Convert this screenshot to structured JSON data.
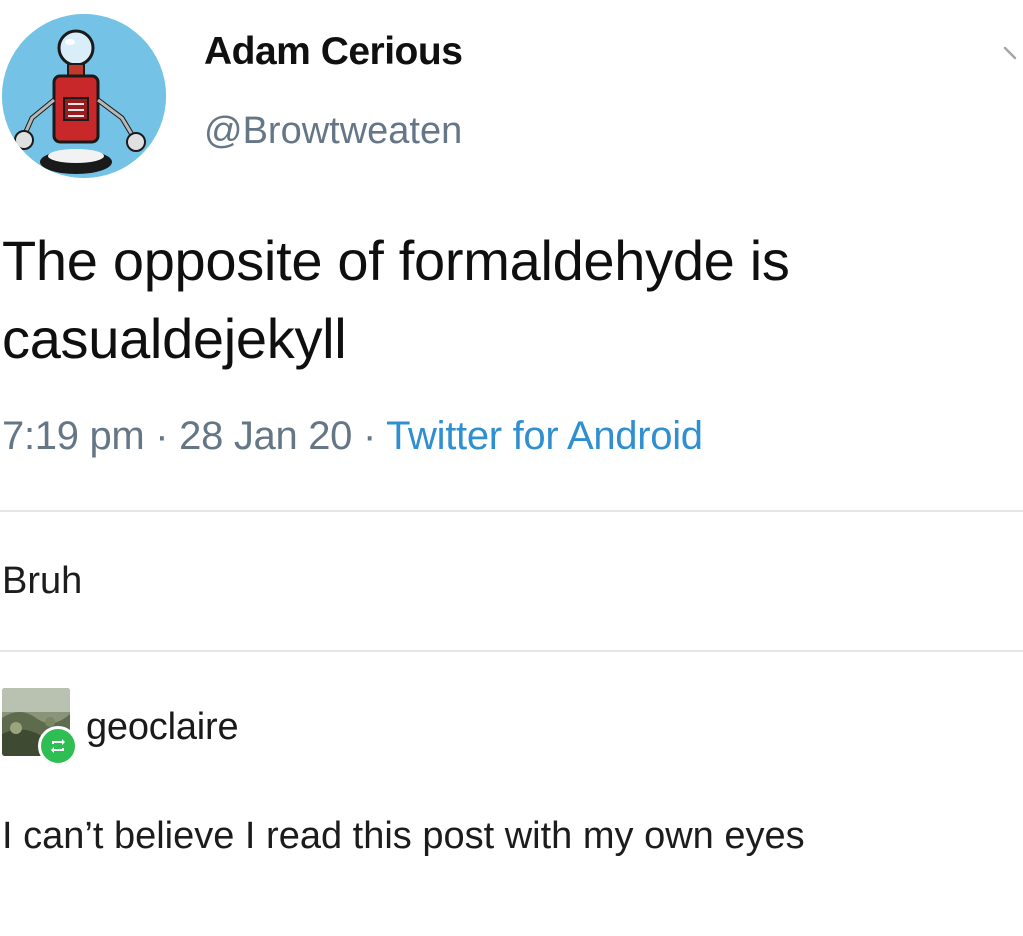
{
  "tweet": {
    "display_name": "Adam Cerious",
    "handle": "@Browtweaten",
    "text": "The opposite of formaldehyde is casualdejekyll",
    "time": "7:19 pm",
    "date": "28 Jan 20",
    "separator": "·",
    "source": "Twitter for Android",
    "avatar_icon": "robot-avatar-icon",
    "menu_icon": "chevron-down-icon"
  },
  "reply": {
    "text": "Bruh"
  },
  "reblog": {
    "username": "geoclaire",
    "comment": "I can’t believe I read this post with my own eyes",
    "badge_icon": "reblog-icon",
    "badge_color": "#2fbe54"
  },
  "colors": {
    "meta_gray": "#657786",
    "link_blue": "#2f8fd0",
    "avatar_bg": "#74c3e6"
  }
}
